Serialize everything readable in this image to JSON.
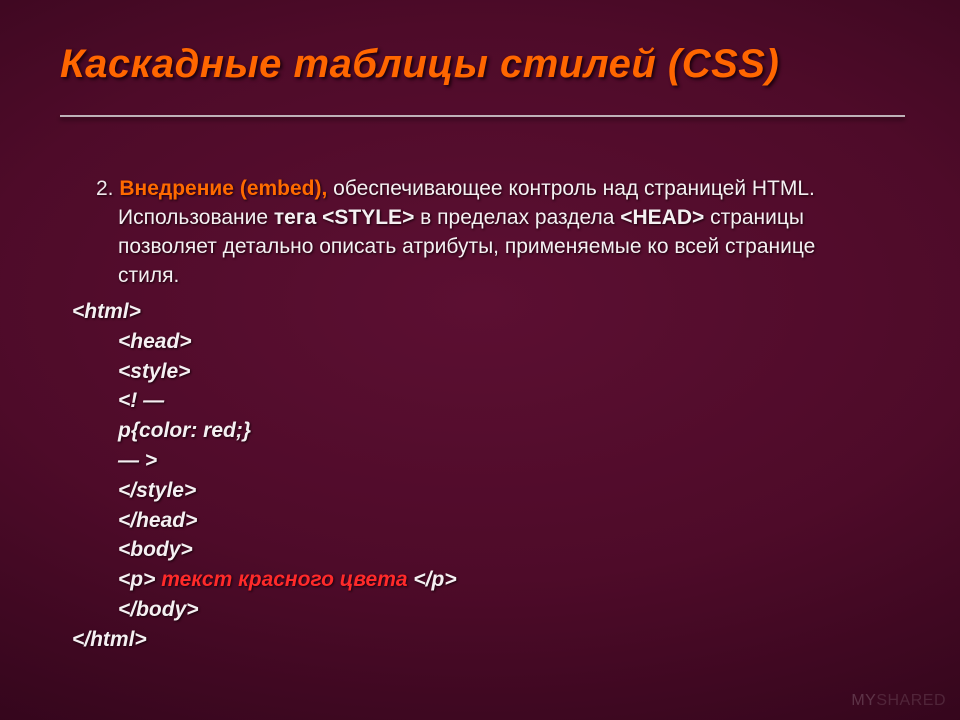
{
  "title": "Каскадные таблицы стилей (CSS)",
  "body": {
    "num": "2.",
    "lead": " Внедрение (embed),",
    "rest1": " обеспечивающее контроль над страницей HTML. Использование ",
    "tag_word": "тега ",
    "style_tag": "<STYLE>",
    "rest2": " в пределах раздела ",
    "head_tag": "<HEAD>",
    "rest3": " страницы позволяет детально описать атрибуты, применяемые ко всей странице стиля."
  },
  "code": {
    "l1": "<html>",
    "l2": "<head>",
    "l3": "<style>",
    "l4": "<! —",
    "l5": "p{color: red;}",
    "l6": "— >",
    "l7": "</style>",
    "l8": "</head>",
    "l9": "<body>",
    "l10_open": "<p> ",
    "l10_red": "текст красного цвета",
    "l10_close": " </p>",
    "l11": "</body>",
    "l12": "</html>"
  },
  "watermark": {
    "my": "MY",
    "shared": "SHARED"
  }
}
